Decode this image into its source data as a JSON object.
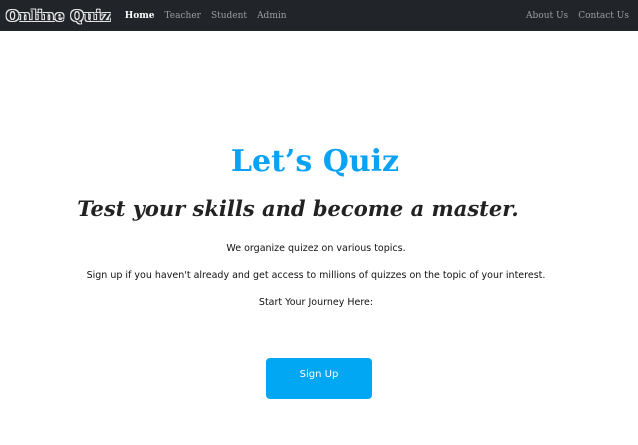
{
  "navbar": {
    "brand": "Online Quiz",
    "left_links": [
      "Home",
      "Teacher",
      "Student",
      "Admin"
    ],
    "right_links": [
      "About Us",
      "Contact Us"
    ],
    "active": "Home"
  },
  "hero": {
    "title": "Let’s Quiz",
    "tagline": "Test your skills and become a master.",
    "paragraphs": [
      "We organize quizez on various topics.",
      "Sign up if you haven't already and get access to millions of quizzes on the topic of your interest.",
      "Start Your Journey Here:"
    ],
    "signup_label": "Sign Up"
  },
  "colors": {
    "navbar_bg": "#212529",
    "accent": "#0aa2f2",
    "button_bg": "#02a7f4"
  }
}
